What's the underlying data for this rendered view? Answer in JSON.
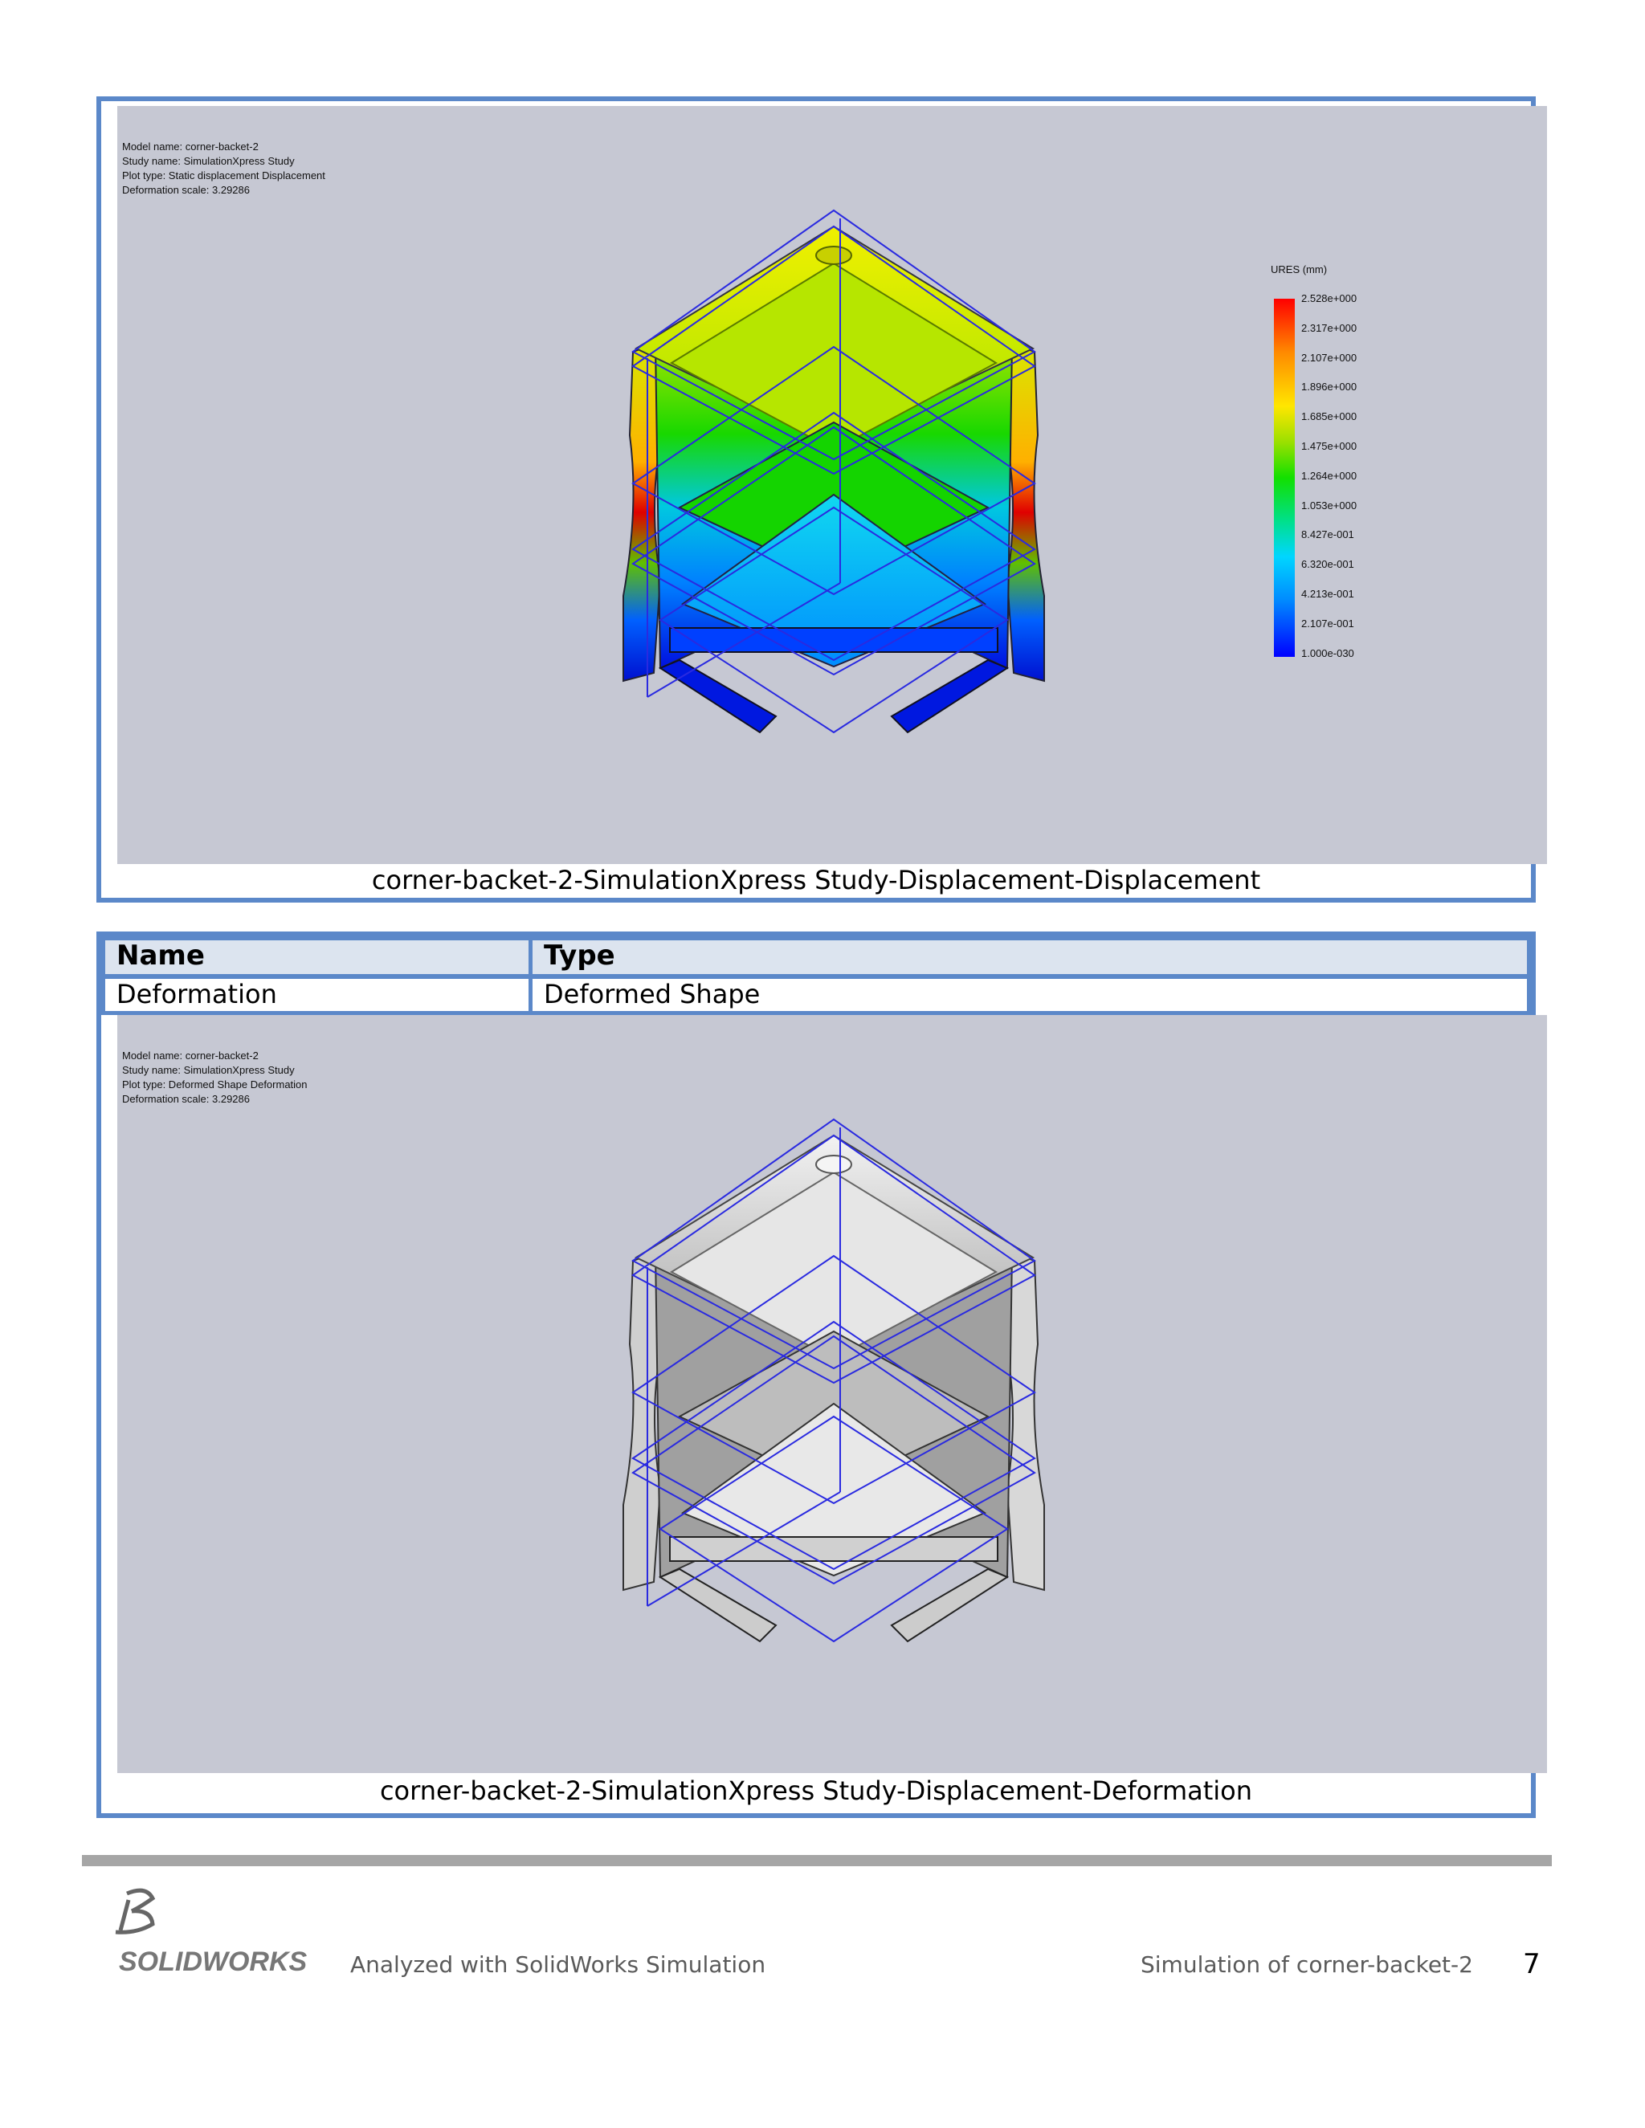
{
  "plot1": {
    "info_lines": [
      "Model name: corner-backet-2",
      "Study name: SimulationXpress Study",
      "Plot type: Static displacement Displacement",
      "Deformation scale: 3.29286"
    ],
    "legend_title": "URES (mm)",
    "legend_values": [
      "2.528e+000",
      "2.317e+000",
      "2.107e+000",
      "1.896e+000",
      "1.685e+000",
      "1.475e+000",
      "1.264e+000",
      "1.053e+000",
      "8.427e-001",
      "6.320e-001",
      "4.213e-001",
      "2.107e-001",
      "1.000e-030"
    ],
    "caption": "corner-backet-2-SimulationXpress Study-Displacement-Displacement"
  },
  "table": {
    "header_name": "Name",
    "header_type": "Type",
    "row_name": "Deformation",
    "row_type": "Deformed Shape"
  },
  "plot2": {
    "info_lines": [
      "Model name: corner-backet-2",
      "Study name: SimulationXpress Study",
      "Plot type: Deformed Shape Deformation",
      "Deformation scale: 3.29286"
    ],
    "caption": "corner-backet-2-SimulationXpress Study-Displacement-Deformation"
  },
  "footer": {
    "logo_text": "SOLIDWORKS",
    "left_text": "Analyzed with SolidWorks Simulation",
    "right_text": "Simulation of corner-backet-2",
    "page_number": "7"
  }
}
